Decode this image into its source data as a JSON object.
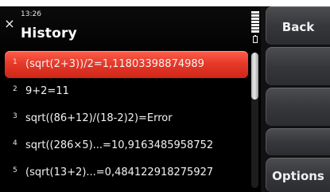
{
  "status": {
    "time": "13:26"
  },
  "title": "History",
  "icons": {
    "close": "close-icon",
    "signal": "signal-strength-icon",
    "battery": "battery-icon"
  },
  "history": [
    {
      "number": "1",
      "text": "(sqrt(2+3))/2=1,11803398874989",
      "selected": true
    },
    {
      "number": "2",
      "text": "9+2=11",
      "selected": false
    },
    {
      "number": "3",
      "text": "sqrt((86+12)/(18-2)2)=Error",
      "selected": false
    },
    {
      "number": "4",
      "text": "sqrt((286×5)...=10,9163485958752",
      "selected": false
    },
    {
      "number": "5",
      "text": "(sqrt(13+2)...=0,484122918275927",
      "selected": false
    }
  ],
  "scrollbar": {
    "visible_fraction": 0.35,
    "position": 0
  },
  "softkeys": {
    "back": "Back",
    "options": "Options"
  },
  "colors": {
    "selection": "#e63a2a",
    "softkey": "#3a3c3f",
    "background": "#000000"
  }
}
